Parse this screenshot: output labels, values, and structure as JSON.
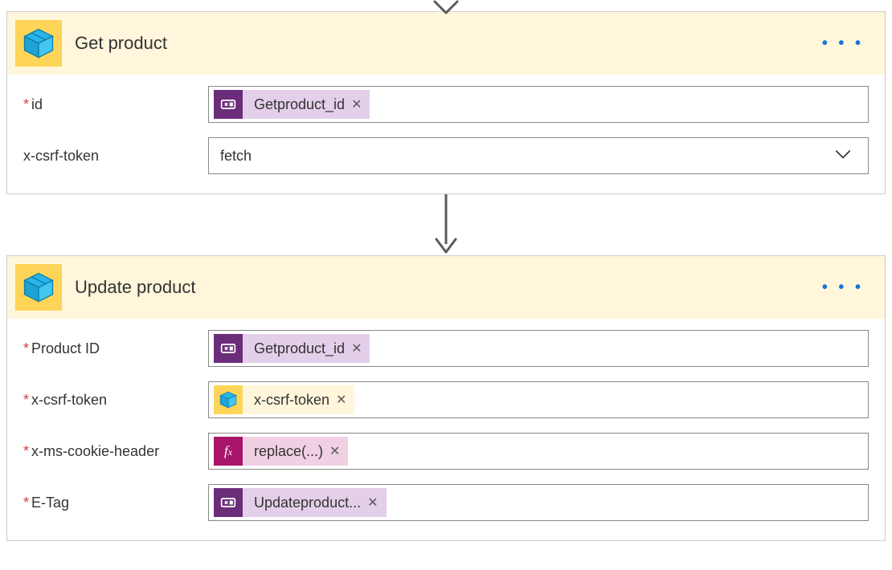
{
  "actions": {
    "getProduct": {
      "title": "Get product",
      "iconName": "package-icon",
      "params": {
        "id": {
          "label": "id",
          "required": true,
          "token": {
            "kind": "variable",
            "text": "Getproduct_id"
          }
        },
        "csrf": {
          "label": "x-csrf-token",
          "required": false,
          "select": "fetch"
        }
      }
    },
    "updateProduct": {
      "title": "Update product",
      "iconName": "package-icon",
      "params": {
        "productId": {
          "label": "Product ID",
          "required": true,
          "token": {
            "kind": "variable",
            "text": "Getproduct_id"
          }
        },
        "csrf": {
          "label": "x-csrf-token",
          "required": true,
          "token": {
            "kind": "action-output",
            "text": "x-csrf-token"
          }
        },
        "cookie": {
          "label": "x-ms-cookie-header",
          "required": true,
          "token": {
            "kind": "expression",
            "text": "replace(...)"
          }
        },
        "etag": {
          "label": "E-Tag",
          "required": true,
          "token": {
            "kind": "variable",
            "text": "Updateproduct..."
          }
        }
      }
    }
  },
  "ui": {
    "menuDots": "• • •"
  }
}
